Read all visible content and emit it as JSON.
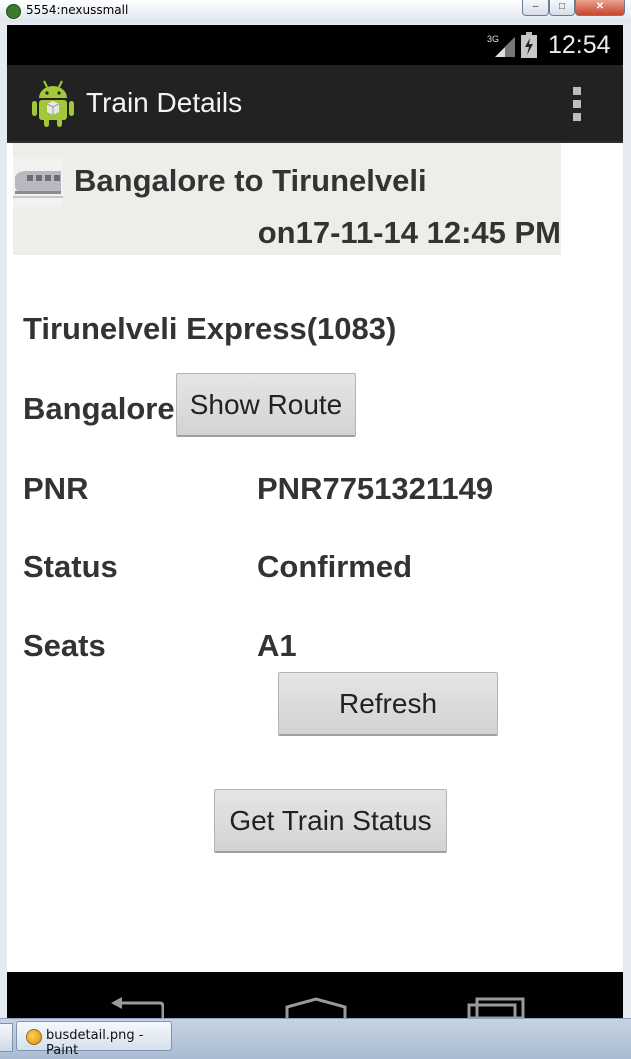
{
  "window": {
    "title": "5554:nexussmall",
    "minimize_glyph": "–",
    "maximize_glyph": "□",
    "close_glyph": "✕"
  },
  "status_bar": {
    "network": "3G",
    "time": "12:54"
  },
  "action_bar": {
    "title": "Train Details"
  },
  "journey": {
    "route": "Bangalore to Tirunelveli",
    "date": "on17-11-14 12:45 PM"
  },
  "train": {
    "name": "Tirunelveli Express(1083)",
    "origin": "Bangalore",
    "show_route_label": "Show Route"
  },
  "details": [
    {
      "label": "PNR",
      "value": "PNR7751321149"
    },
    {
      "label": "Status",
      "value": "Confirmed"
    },
    {
      "label": "Seats",
      "value": "A1"
    }
  ],
  "buttons": {
    "refresh": "Refresh",
    "get_status": "Get Train Status"
  },
  "taskbar": {
    "item_label": "busdetail.png - Paint"
  },
  "icons": {
    "app": "android-robot-icon",
    "overflow": "overflow-menu-icon",
    "signal": "signal-3g-icon",
    "battery": "battery-charging-icon",
    "train": "train-icon",
    "nav_back": "back-icon",
    "nav_home": "home-icon",
    "nav_recents": "recent-apps-icon"
  },
  "colors": {
    "action_bar": "#222222",
    "header_bg": "#eeede8",
    "text": "#333333",
    "android_green": "#a4c639"
  }
}
